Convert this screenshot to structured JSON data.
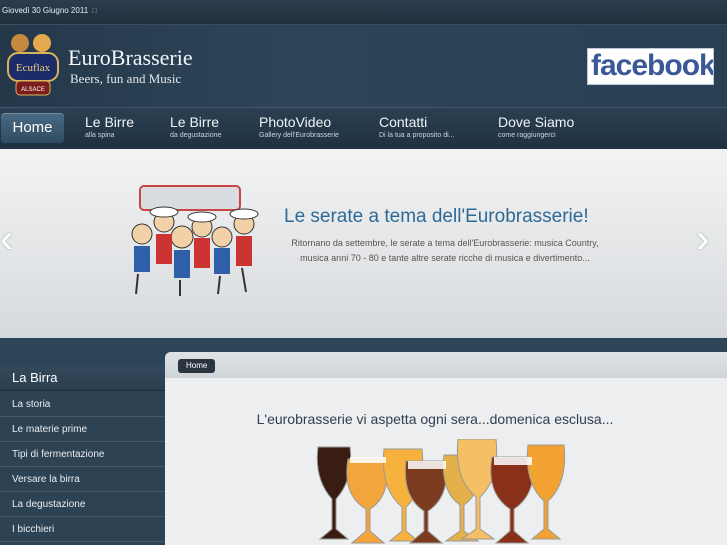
{
  "topbar": {
    "date": "Giovedì 30 Giugno 2011",
    "dot": "□"
  },
  "header": {
    "title": "EuroBrasserie",
    "subtitle": "Beers, fun and Music",
    "facebook": "facebook"
  },
  "nav": {
    "home": "Home",
    "items": [
      {
        "title": "Le Birre",
        "sub": "alla spina"
      },
      {
        "title": "Le Birre",
        "sub": "da degustazione"
      },
      {
        "title": "PhotoVideo",
        "sub": "Gallery dell'Eurobrasserie"
      },
      {
        "title": "Contatti",
        "sub": "Di la tua a proposito di..."
      },
      {
        "title": "Dove Siamo",
        "sub": "come raggiungerci"
      }
    ]
  },
  "slider": {
    "title": "Le serate a tema dell'Eurobrasserie!",
    "text": "Ritornano da settembre, le serate a tema dell'Eurobrasserie: musica Country, musica anni 70 - 80 e tante altre serate ricche di musica e divertimento...",
    "prev": "‹",
    "next": "›"
  },
  "sidebar": {
    "heading": "La Birra",
    "items": [
      "La storia",
      "Le materie prime",
      "Tipi di fermentazione",
      "Versare la birra",
      "La degustazione",
      "I bicchieri"
    ]
  },
  "content": {
    "breadcrumb": "Home",
    "title": "L'eurobrasserie vi aspetta ogni sera...domenica esclusa..."
  }
}
